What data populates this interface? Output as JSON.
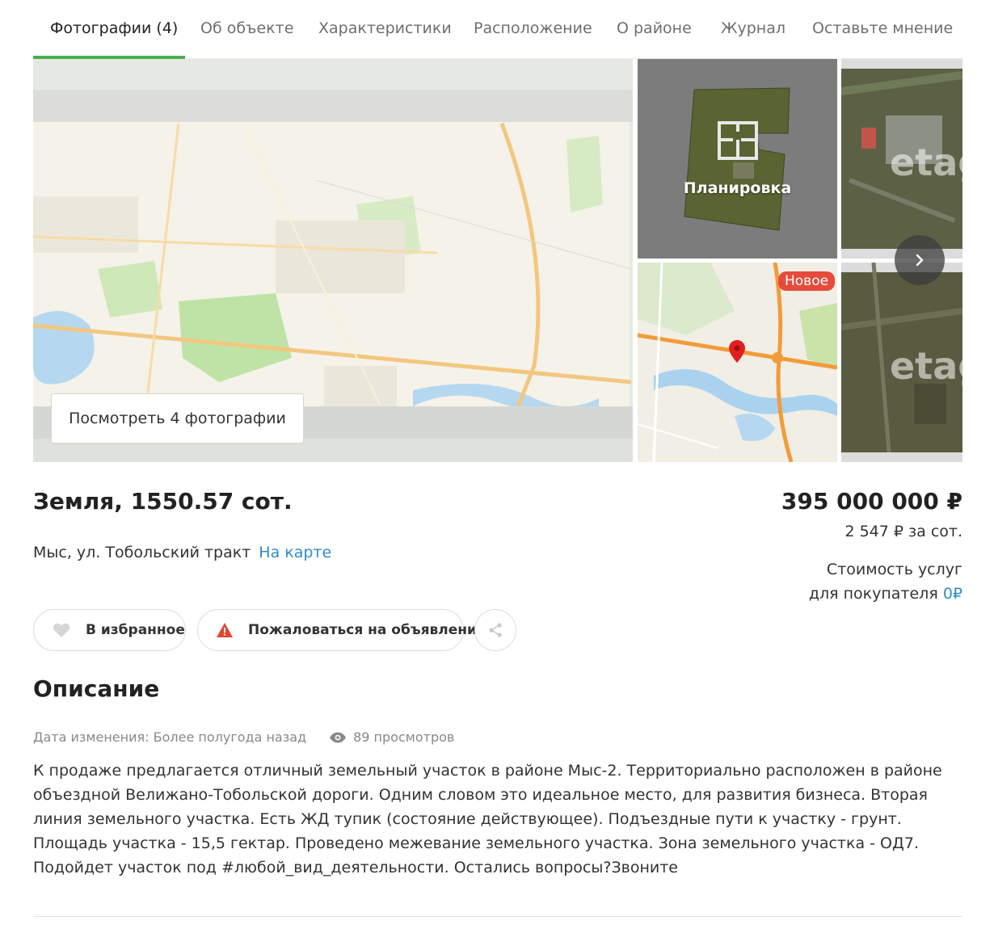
{
  "tabs": [
    {
      "label": "Фотографии (4)",
      "active": true
    },
    {
      "label": "Об объекте"
    },
    {
      "label": "Характеристики"
    },
    {
      "label": "Расположение"
    },
    {
      "label": "О районе"
    },
    {
      "label": "Журнал"
    },
    {
      "label": "Оставьте мнение"
    }
  ],
  "gallery": {
    "view_photos_label": "Посмотреть 4 фотографии",
    "plan_label": "Планировка",
    "new_badge": "Новое",
    "watermark": "etag",
    "next_icon": "chevron-right-icon"
  },
  "listing": {
    "title": "Земля, 1550.57 сот.",
    "address": "Мыс, ул. Тобольский тракт",
    "map_link": "На карте",
    "price": "395 000 000 ₽",
    "price_per_unit": "2 547 ₽ за сот.",
    "services_line1": "Стоимость услуг",
    "services_line2": "для покупателя",
    "services_value": "0₽"
  },
  "actions": {
    "favorite_label": "В избранное",
    "complain_label": "Пожаловаться на объявление",
    "share_icon": "share-icon"
  },
  "description": {
    "heading": "Описание",
    "changed": "Дата изменения: Более полугода назад",
    "views": "89 просмотров",
    "text": "К продаже предлагается отличный земельный участок в районе Мыс-2. Территориально расположен в районе объездной Велижано-Тобольской дороги. Одним словом это идеальное место, для развития бизнеса. Вторая линия земельного участка. Есть ЖД тупик (состояние действующее). Подъездные пути к участку - грунт. Площадь участка - 15,5 гектар. Проведено межевание земельного участка. Зона земельного участка - ОД7. Подойдет участок под #любой_вид_деятельности. Остались вопросы?Звоните"
  },
  "colors": {
    "accent_green": "#4caf50",
    "link_blue": "#2f8bc9",
    "badge_red": "#e64a3b",
    "warning_red": "#e0452f"
  }
}
